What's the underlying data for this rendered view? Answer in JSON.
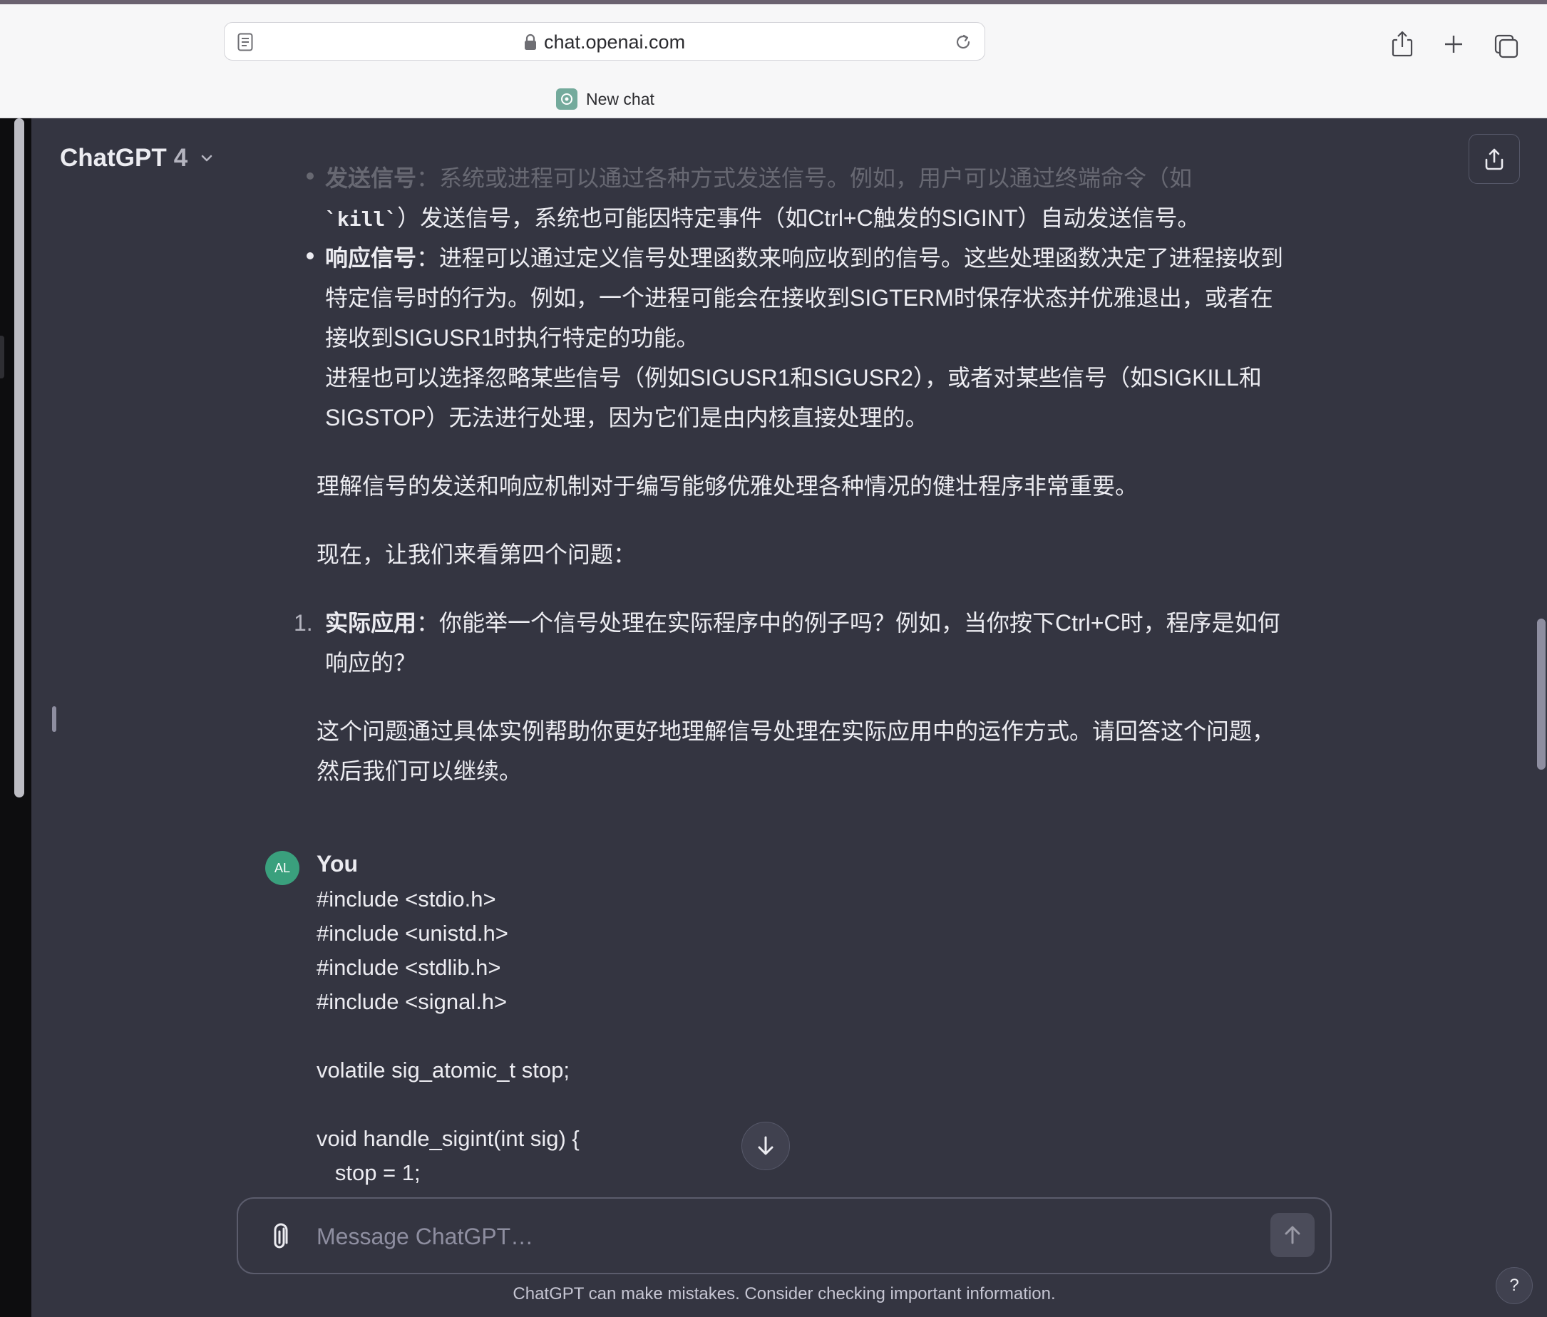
{
  "browser": {
    "url": "chat.openai.com",
    "tab_title": "New chat"
  },
  "app": {
    "model_name": "ChatGPT",
    "model_version": "4"
  },
  "assistant_message": {
    "bullets": [
      {
        "term": "发送信号",
        "lines": [
          "：系统或进程可以通过各种方式发送信号。例如，用户可以通过终端命令（如",
          "）发送信号，系统也可能因特定事件（如Ctrl+C触发的SIGINT）自动发送信号。"
        ],
        "code": "`kill`"
      },
      {
        "term": "响应信号",
        "lines": [
          "：进程可以通过定义信号处理函数来响应收到的信号。这些处理函数决定了进程接收到",
          "特定信号时的行为。例如，一个进程可能会在接收到SIGTERM时保存状态并优雅退出，或者在",
          "接收到SIGUSR1时执行特定的功能。",
          "进程也可以选择忽略某些信号（例如SIGUSR1和SIGUSR2），或者对某些信号（如SIGKILL和",
          "SIGSTOP）无法进行处理，因为它们是由内核直接处理的。"
        ]
      }
    ],
    "paragraph1": "理解信号的发送和响应机制对于编写能够优雅处理各种情况的健壮程序非常重要。",
    "paragraph2": "现在，让我们来看第四个问题：",
    "numbered": {
      "marker": "1.",
      "term": "实际应用",
      "lines": [
        "：你能举一个信号处理在实际程序中的例子吗？例如，当你按下Ctrl+C时，程序是如何",
        "响应的？"
      ]
    },
    "closing_lines": [
      "这个问题通过具体实例帮助你更好地理解信号处理在实际应用中的运作方式。请回答这个问题，",
      "然后我们可以继续。"
    ]
  },
  "user_message": {
    "avatar_initials": "AL",
    "author": "You",
    "code_lines": [
      "#include <stdio.h>",
      "#include <unistd.h>",
      "#include <stdlib.h>",
      "#include <signal.h>",
      "",
      "volatile sig_atomic_t stop;",
      "",
      "void handle_sigint(int sig) {",
      "   stop = 1;"
    ]
  },
  "composer": {
    "placeholder": "Message ChatGPT…",
    "value": ""
  },
  "footer": {
    "disclaimer": "ChatGPT can make mistakes. Consider checking important information.",
    "help_label": "?"
  },
  "colors": {
    "background": "#343541",
    "text": "#ececf1",
    "avatar": "#3aa07d",
    "chrome": "#f7f7f8"
  },
  "icons": {
    "reader": "reader-view-icon",
    "lock": "lock-icon",
    "reload": "reload-icon",
    "share": "share-icon",
    "new_tab": "plus-icon",
    "tabs": "tabs-overview-icon",
    "chevron": "chevron-down-icon",
    "upload": "upload-share-icon",
    "scroll_down": "arrow-down-icon",
    "attach": "paperclip-icon",
    "send": "arrow-up-icon"
  }
}
